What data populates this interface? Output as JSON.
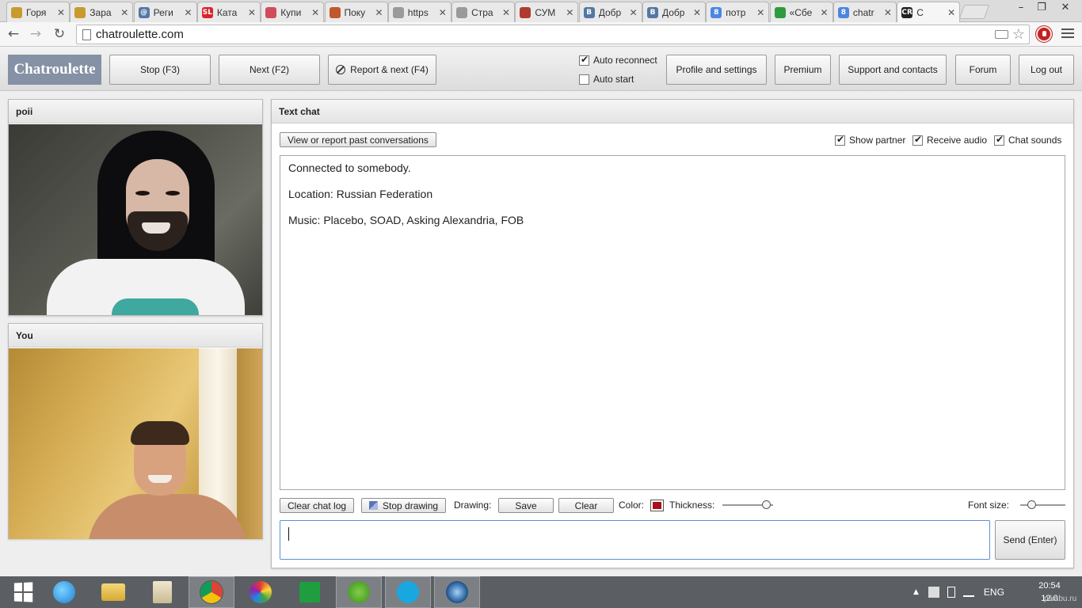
{
  "browser": {
    "tabs": [
      {
        "title": "Горя",
        "color": "#c99a2e",
        "glyph": ""
      },
      {
        "title": "Зара",
        "color": "#c99a2e",
        "glyph": ""
      },
      {
        "title": "Реги",
        "color": "#5277a8",
        "glyph": "@"
      },
      {
        "title": "Ката",
        "color": "#d8252b",
        "glyph": "SL"
      },
      {
        "title": "Купи",
        "color": "#d04c5a",
        "glyph": ""
      },
      {
        "title": "Поку",
        "color": "#c0582b",
        "glyph": ""
      },
      {
        "title": "https",
        "color": "#9a9a9a",
        "glyph": ""
      },
      {
        "title": "Стра",
        "color": "#9a9a9a",
        "glyph": ""
      },
      {
        "title": "СУМ",
        "color": "#b03a2e",
        "glyph": ""
      },
      {
        "title": "Добр",
        "color": "#5278a3",
        "glyph": "B"
      },
      {
        "title": "Добр",
        "color": "#5278a3",
        "glyph": "B"
      },
      {
        "title": "потр",
        "color": "#4d86e0",
        "glyph": "8"
      },
      {
        "title": "«Сбе",
        "color": "#2f9b3c",
        "glyph": ""
      },
      {
        "title": "chatr",
        "color": "#4d86e0",
        "glyph": "8"
      },
      {
        "title": "С",
        "color": "#222222",
        "glyph": "CR"
      }
    ],
    "url": "chatroulette.com"
  },
  "header": {
    "logo": "Chatroulette",
    "stop_label": "Stop (F3)",
    "next_label": "Next (F2)",
    "report_label": "Report & next (F4)",
    "auto_reconnect_label": "Auto reconnect",
    "auto_reconnect_checked": true,
    "auto_start_label": "Auto start",
    "auto_start_checked": false,
    "profile_label": "Profile and settings",
    "premium_label": "Premium",
    "support_label": "Support and contacts",
    "forum_label": "Forum",
    "logout_label": "Log out"
  },
  "partner": {
    "name": "poii"
  },
  "self": {
    "name": "You"
  },
  "chat": {
    "title": "Text chat",
    "past_conversations_label": "View or report past conversations",
    "show_partner_label": "Show partner",
    "receive_audio_label": "Receive audio",
    "chat_sounds_label": "Chat sounds",
    "messages": [
      "Connected to somebody.",
      "Location: Russian Federation",
      "Music: Placebo, SOAD, Asking Alexandria, FOB"
    ],
    "clear_log_label": "Clear chat log",
    "stop_drawing_label": "Stop drawing",
    "drawing_label": "Drawing:",
    "save_label": "Save",
    "clear_label": "Clear",
    "color_label": "Color:",
    "color_value": "#a8111a",
    "thickness_label": "Thickness:",
    "thickness_level": 0.95,
    "font_size_label": "Font size:",
    "font_size_level": 0.2,
    "input_value": "",
    "send_label": "Send (Enter)"
  },
  "taskbar": {
    "language": "ENG",
    "time": "20:54",
    "date": "12.0",
    "watermark": "pikabu.ru"
  }
}
